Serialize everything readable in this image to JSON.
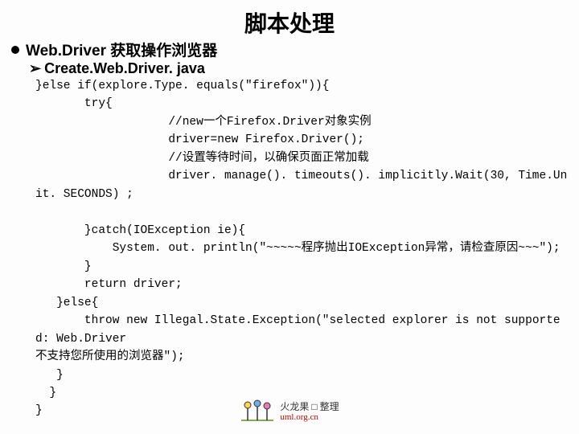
{
  "title": "脚本处理",
  "bullet1": "Web.Driver 获取操作浏览器",
  "bullet2": "Create.Web.Driver. java",
  "code_lines": [
    "}else if(explore.Type. equals(\"firefox\")){",
    "       try{",
    "                   //new一个Firefox.Driver对象实例",
    "                   driver=new Firefox.Driver();",
    "                   //设置等待时间，以确保页面正常加载",
    "                   driver. manage(). timeouts(). implicitly.Wait(30, Time.Unit. SECONDS) ;",
    "",
    "       }catch(IOException ie){",
    "           System. out. println(\"~~~~~程序抛出IOException异常，请检查原因~~~\");",
    "       }",
    "       return driver;",
    "   }else{",
    "       throw new Illegal.State.Exception(\"selected explorer is not supported: Web.Driver",
    "不支持您所使用的浏览器\");",
    "   }",
    "  }",
    "}"
  ],
  "footer": {
    "line1": "火龙果 □ 整理",
    "line2": "uml.org.cn"
  }
}
